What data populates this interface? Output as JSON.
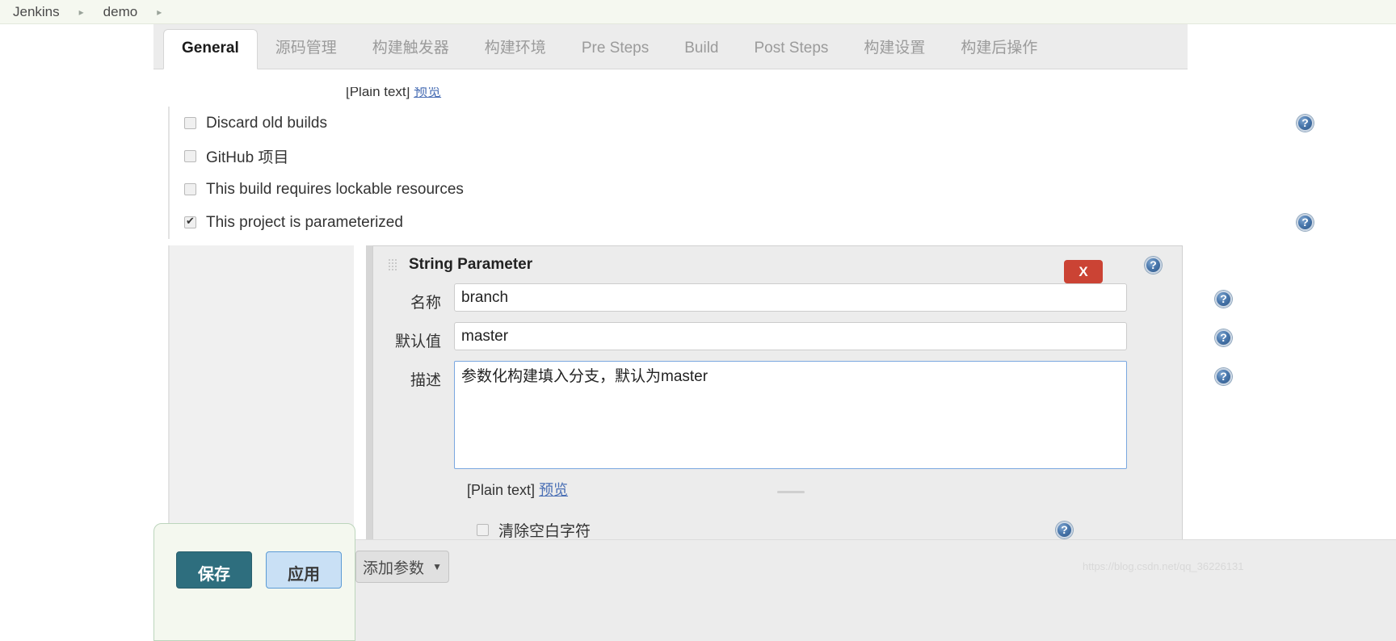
{
  "breadcrumb": {
    "items": [
      "Jenkins",
      "demo"
    ],
    "separator": "▸"
  },
  "tabs": [
    {
      "label": "General",
      "active": true
    },
    {
      "label": "源码管理",
      "active": false
    },
    {
      "label": "构建触发器",
      "active": false
    },
    {
      "label": "构建环境",
      "active": false
    },
    {
      "label": "Pre Steps",
      "active": false
    },
    {
      "label": "Build",
      "active": false
    },
    {
      "label": "Post Steps",
      "active": false
    },
    {
      "label": "构建设置",
      "active": false
    },
    {
      "label": "构建后操作",
      "active": false
    }
  ],
  "top_plaintext": {
    "prefix": "[Plain text]",
    "preview_link": "预览"
  },
  "checkboxes": [
    {
      "label": "Discard old builds",
      "checked": false,
      "help": true
    },
    {
      "label": "GitHub 项目",
      "checked": false,
      "help": false
    },
    {
      "label": "This build requires lockable resources",
      "checked": false,
      "help": false
    },
    {
      "label": "This project is parameterized",
      "checked": true,
      "help": true
    }
  ],
  "parameter": {
    "title": "String Parameter",
    "grip_icon": "drag-grip-icon",
    "remove_label": "X",
    "remove_color": "#cb4334",
    "fields": [
      {
        "label": "名称",
        "value": "branch",
        "type": "text"
      },
      {
        "label": "默认值",
        "value": "master",
        "type": "text"
      },
      {
        "label": "描述",
        "value": "参数化构建填入分支，默认为master",
        "type": "textarea"
      }
    ],
    "plaintext": {
      "prefix": "[Plain text]",
      "preview_link": "预览"
    },
    "trim_checkbox": {
      "label": "清除空白字符",
      "checked": false
    }
  },
  "buttons": {
    "save": "保存",
    "apply": "应用",
    "add_parameter": "添加参数",
    "add_parameter_caret": "▼"
  },
  "icons": {
    "help": "?"
  },
  "watermark": "https://blog.csdn.net/qq_36226131",
  "colors": {
    "breadcrumb_bg": "#f5f8f0",
    "save_button": "#2e6e7e",
    "apply_button": "#c9e0f5",
    "remove_button": "#cb4334",
    "link": "#4a6fb5",
    "panel_bg": "#ececec"
  }
}
